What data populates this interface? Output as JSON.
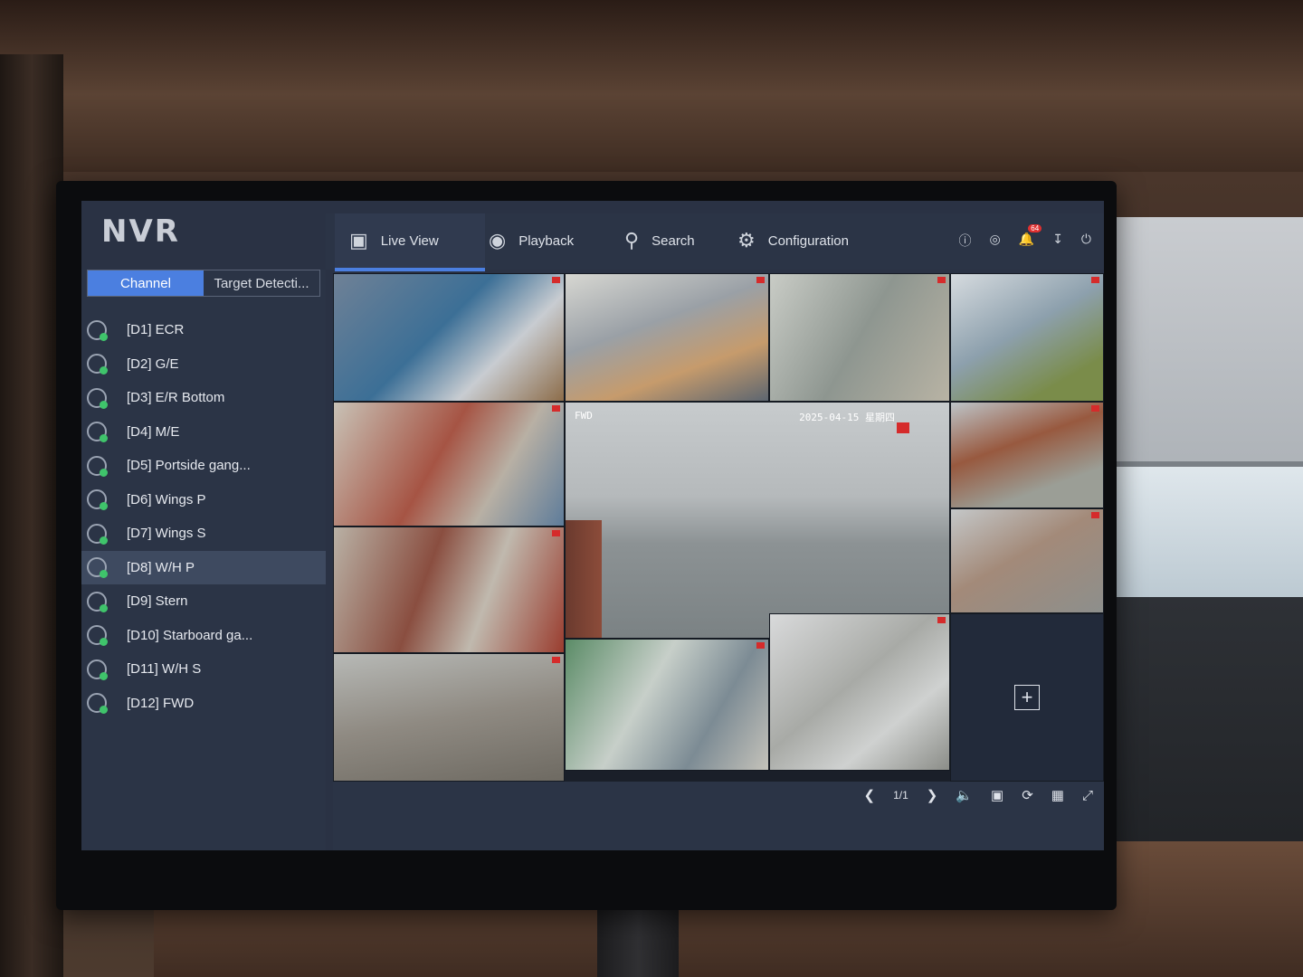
{
  "app": {
    "title": "NVR"
  },
  "nav": {
    "tabs": [
      {
        "label": "Live View",
        "icon": "camera-icon"
      },
      {
        "label": "Playback",
        "icon": "playback-icon"
      },
      {
        "label": "Search",
        "icon": "search-icon"
      },
      {
        "label": "Configuration",
        "icon": "gear-icon"
      }
    ],
    "active_tab": "Live View",
    "notification_count": "64"
  },
  "sidebar": {
    "tabs": [
      {
        "label": "Channel"
      },
      {
        "label": "Target Detecti..."
      }
    ],
    "channels": [
      {
        "label": "[D1] ECR"
      },
      {
        "label": "[D2] G/E"
      },
      {
        "label": "[D3] E/R Bottom"
      },
      {
        "label": "[D4] M/E"
      },
      {
        "label": "[D5] Portside gang..."
      },
      {
        "label": "[D6] Wings P"
      },
      {
        "label": "[D7] Wings S"
      },
      {
        "label": "[D8] W/H P"
      },
      {
        "label": "[D9] Stern"
      },
      {
        "label": "[D10] Starboard ga..."
      },
      {
        "label": "[D11] W/H S"
      },
      {
        "label": "[D12] FWD"
      }
    ],
    "selected_channel": "[D8] W/H P"
  },
  "main_view": {
    "label": "FWD",
    "date": "2025-04-15",
    "weekday": "星期四"
  },
  "toolbar": {
    "page": "1/1"
  },
  "colors": {
    "accent": "#4b7fe0",
    "panel": "#2b3446",
    "status_online": "#3fc46b",
    "record": "#d52b2b"
  }
}
